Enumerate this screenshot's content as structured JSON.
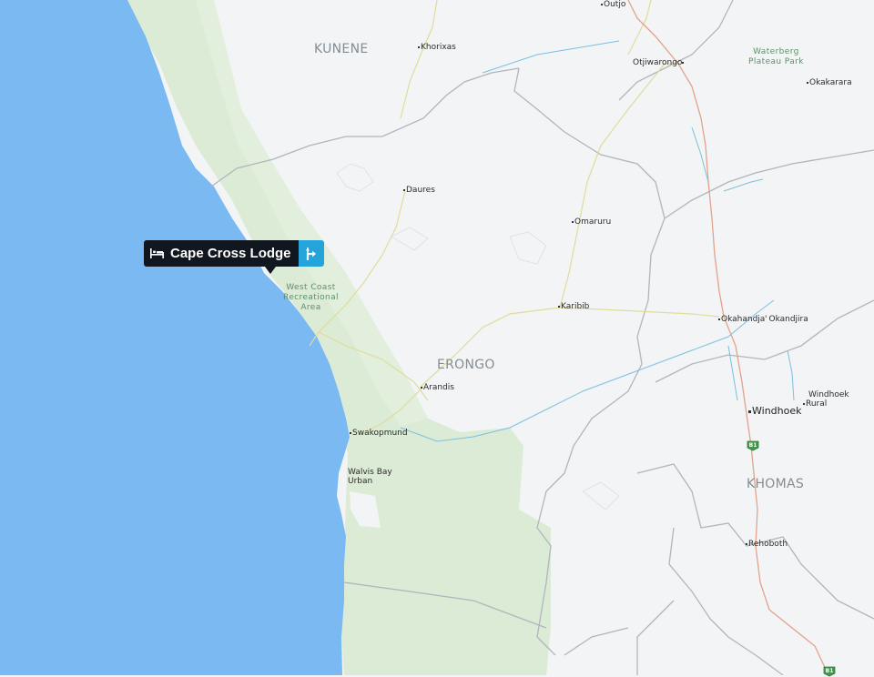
{
  "map": {
    "regions": [
      "KUNENE",
      "ERONGO",
      "KHOMAS"
    ],
    "park_name_lines": [
      "Waterberg",
      "Plateau Park"
    ],
    "protected_area_lines": [
      "West Coast",
      "Recreational",
      "Area"
    ],
    "towns": {
      "outjo": "Outjo",
      "khorixas": "Khorixas",
      "otjiwarongo": "Otjiwarongo",
      "okakarara": "Okakarara",
      "daures": "Daures",
      "omaruru": "Omaruru",
      "karibib": "Karibib",
      "okahandja": "Okahandja",
      "okandjira": "Okandjira",
      "arandis": "Arandis",
      "swakopmund": "Swakopmund",
      "walvis_bay_1": "Walvis Bay",
      "walvis_bay_2": "Urban",
      "windhoek": "Windhoek",
      "windhoek_rural_1": "Windhoek",
      "windhoek_rural_2": "Rural",
      "rehoboth": "Rehoboth"
    },
    "road_shields": [
      "B1",
      "B1",
      "B1"
    ]
  },
  "marker": {
    "title": "Cape Cross Lodge",
    "type_icon": "bed-icon",
    "action_icon": "directions-icon",
    "colors": {
      "label_bg": "#10171f",
      "action_bg": "#25a4dc"
    }
  },
  "colors": {
    "ocean": "#7bb9f3",
    "land": "#f2f4f5",
    "park": "#dbebd6",
    "border": "#b0b6bb",
    "river": "#7dbfe0",
    "road": "#e0dc9a",
    "main_road": "#e3a28e"
  }
}
